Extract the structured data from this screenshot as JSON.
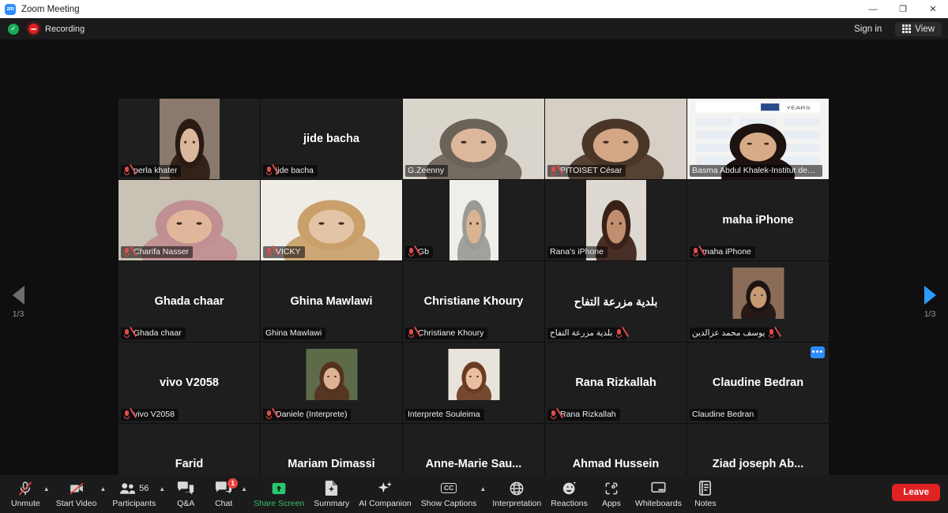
{
  "window": {
    "title": "Zoom Meeting",
    "logo_text": "zm",
    "minimize": "—",
    "maximize": "❐",
    "close": "✕"
  },
  "topbar": {
    "shield_icon": "shield-check-icon",
    "shield_glyph": "✓",
    "recording_icon": "recording-icon",
    "recording_label": "Recording",
    "sign_in_label": "Sign in",
    "view_label": "View",
    "view_icon": "grid-icon"
  },
  "stage": {
    "prev_arrow_icon": "chevron-left-icon",
    "next_arrow_icon": "chevron-right-icon",
    "page_indicator_left": "1/3",
    "page_indicator_right": "1/3"
  },
  "participants": [
    {
      "name": "perla khater",
      "display": "video",
      "muted": true,
      "active": false,
      "video_kind": "portrait-inset",
      "sky": "#8a7a6c",
      "skin": "#d9b79a",
      "hair": "#2a1a14"
    },
    {
      "name": "jide bacha",
      "display": "name",
      "muted": true,
      "active": false
    },
    {
      "name": "G.Zeenny",
      "display": "video",
      "muted": false,
      "active": false,
      "video_kind": "full",
      "sky": "#d9d5cc",
      "skin": "#dcb79c",
      "hair": "#6b6258"
    },
    {
      "name": "PITOISET César",
      "display": "video",
      "muted": true,
      "active": false,
      "video_kind": "full",
      "sky": "#d5cfc6",
      "skin": "#d3a686",
      "hair": "#4a3626"
    },
    {
      "name": "Basma Abdul Khalek-Institut des Fina...",
      "display": "video",
      "muted": false,
      "active": true,
      "video_kind": "slide",
      "sky": "#f2f2f0",
      "skin": "#d8ab88",
      "hair": "#1c1210"
    },
    {
      "name": "Charifa Nasser",
      "display": "video",
      "muted": true,
      "active": false,
      "video_kind": "full",
      "sky": "#c9c3b5",
      "skin": "#e0b79a",
      "hair": "#c08f92"
    },
    {
      "name": "VICKY",
      "display": "video",
      "muted": true,
      "active": false,
      "video_kind": "full",
      "sky": "#efece6",
      "skin": "#e3c4a6",
      "hair": "#c9a06a"
    },
    {
      "name": "Gb",
      "display": "video",
      "muted": true,
      "active": false,
      "video_kind": "portrait",
      "sky": "#efeee9",
      "skin": "#d9b392",
      "hair": "#9a9a96"
    },
    {
      "name": "Rana's iPhone",
      "display": "video",
      "muted": false,
      "active": false,
      "video_kind": "portrait2",
      "sky": "#ddd9d2",
      "skin": "#c08f70",
      "hair": "#3a2118"
    },
    {
      "name": "maha iPhone",
      "display": "name",
      "muted": true,
      "active": false
    },
    {
      "name": "Ghada chaar",
      "display": "name",
      "muted": true,
      "active": false
    },
    {
      "name": "Ghina Mawlawi",
      "display": "name",
      "muted": false,
      "active": false
    },
    {
      "name": "Christiane Khoury",
      "display": "name",
      "muted": true,
      "active": false
    },
    {
      "name": "بلدية مزرعة التفاح",
      "display": "name",
      "muted": true,
      "active": false,
      "rtl": true
    },
    {
      "name": "يوسف محمد عزالدين",
      "display": "avatar",
      "muted": true,
      "active": false,
      "rtl": true,
      "sky": "#8a6c58",
      "skin": "#c79a74",
      "hair": "#1c1412"
    },
    {
      "name": "vivo V2058",
      "display": "name",
      "muted": true,
      "active": false
    },
    {
      "name": "Daniele (Interprete)",
      "display": "avatar",
      "muted": true,
      "active": false,
      "sky": "#5d6b4a",
      "skin": "#ddb294",
      "hair": "#55321f"
    },
    {
      "name": "Interprete Souleima",
      "display": "avatar",
      "muted": false,
      "active": false,
      "sky": "#e8e4dc",
      "skin": "#e8bf9e",
      "hair": "#6a3b22"
    },
    {
      "name": "Rana Rizkallah",
      "display": "name",
      "muted": true,
      "active": false
    },
    {
      "name": "Claudine Bedran",
      "display": "name",
      "muted": false,
      "active": false,
      "more": true
    },
    {
      "name": "Farid",
      "display": "name",
      "muted": true,
      "active": false
    },
    {
      "name": "Mariam Dimassi",
      "display": "name",
      "muted": true,
      "active": false
    },
    {
      "name": "Anne-Marie Saulnier",
      "display": "name",
      "muted": true,
      "active": false,
      "center_name": "Anne-Marie Sau..."
    },
    {
      "name": "Ahmad Hussein",
      "display": "name",
      "muted": true,
      "active": false
    },
    {
      "name": "Ziad joseph Abou jaoude",
      "display": "name",
      "muted": true,
      "active": false,
      "center_name": "Ziad joseph Ab..."
    }
  ],
  "toolbar": {
    "items": [
      {
        "label": "Unmute",
        "icon": "microphone-muted-icon",
        "caret": true
      },
      {
        "label": "Start Video",
        "icon": "video-camera-off-icon",
        "caret": true
      },
      {
        "label": "Participants",
        "icon": "participants-icon",
        "count": "56",
        "caret": true
      },
      {
        "label": "Q&A",
        "icon": "question-answer-icon",
        "caret": false
      },
      {
        "label": "Chat",
        "icon": "chat-icon",
        "badge": "1",
        "caret": true
      },
      {
        "label": "Share Screen",
        "icon": "share-screen-icon",
        "caret": false,
        "green": true
      },
      {
        "label": "Summary",
        "icon": "summary-document-icon",
        "caret": false
      },
      {
        "label": "AI Companion",
        "icon": "ai-sparkle-icon",
        "caret": false
      },
      {
        "label": "Show Captions",
        "icon": "closed-caption-icon",
        "caret": true
      },
      {
        "label": "Interpretation",
        "icon": "globe-icon",
        "caret": false
      },
      {
        "label": "Reactions",
        "icon": "reactions-smiley-icon",
        "caret": false
      },
      {
        "label": "Apps",
        "icon": "apps-icon",
        "caret": false
      },
      {
        "label": "Whiteboards",
        "icon": "whiteboard-icon",
        "caret": false
      },
      {
        "label": "Notes",
        "icon": "notes-icon",
        "caret": false
      }
    ],
    "leave_label": "Leave"
  }
}
